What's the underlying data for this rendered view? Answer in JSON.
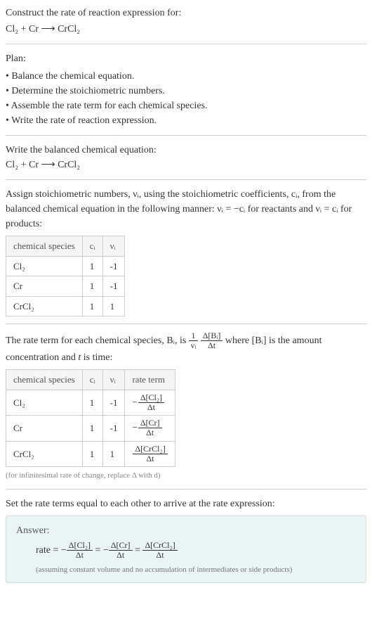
{
  "prompt": {
    "line1": "Construct the rate of reaction expression for:",
    "equation": "Cl₂ + Cr ⟶ CrCl₂"
  },
  "plan": {
    "heading": "Plan:",
    "items": [
      "Balance the chemical equation.",
      "Determine the stoichiometric numbers.",
      "Assemble the rate term for each chemical species.",
      "Write the rate of reaction expression."
    ]
  },
  "balanced": {
    "heading": "Write the balanced chemical equation:",
    "equation": "Cl₂ + Cr ⟶ CrCl₂"
  },
  "assign": {
    "text": "Assign stoichiometric numbers, νᵢ, using the stoichiometric coefficients, cᵢ, from the balanced chemical equation in the following manner: νᵢ = −cᵢ for reactants and νᵢ = cᵢ for products:",
    "table": {
      "headers": [
        "chemical species",
        "cᵢ",
        "νᵢ"
      ],
      "rows": [
        [
          "Cl₂",
          "1",
          "-1"
        ],
        [
          "Cr",
          "1",
          "-1"
        ],
        [
          "CrCl₂",
          "1",
          "1"
        ]
      ]
    }
  },
  "rateterm": {
    "text_prefix": "The rate term for each chemical species, Bᵢ, is ",
    "text_mid": " where [Bᵢ] is the amount concentration and ",
    "t_label": "t",
    "text_suffix": " is time:",
    "frac1_num": "1",
    "frac1_den": "νᵢ",
    "frac2_num": "Δ[Bᵢ]",
    "frac2_den": "Δt",
    "table": {
      "headers": [
        "chemical species",
        "cᵢ",
        "νᵢ",
        "rate term"
      ],
      "rows": [
        {
          "sp": "Cl₂",
          "c": "1",
          "v": "-1",
          "neg": "−",
          "num": "Δ[Cl₂]",
          "den": "Δt"
        },
        {
          "sp": "Cr",
          "c": "1",
          "v": "-1",
          "neg": "−",
          "num": "Δ[Cr]",
          "den": "Δt"
        },
        {
          "sp": "CrCl₂",
          "c": "1",
          "v": "1",
          "neg": "",
          "num": "Δ[CrCl₂]",
          "den": "Δt"
        }
      ]
    },
    "note": "(for infinitesimal rate of change, replace Δ with d)"
  },
  "setequal": {
    "text": "Set the rate terms equal to each other to arrive at the rate expression:"
  },
  "answer": {
    "label": "Answer:",
    "rate_label": "rate = ",
    "neg": "−",
    "eq": " = ",
    "t1_num": "Δ[Cl₂]",
    "t1_den": "Δt",
    "t2_num": "Δ[Cr]",
    "t2_den": "Δt",
    "t3_num": "Δ[CrCl₂]",
    "t3_den": "Δt",
    "note": "(assuming constant volume and no accumulation of intermediates or side products)"
  }
}
